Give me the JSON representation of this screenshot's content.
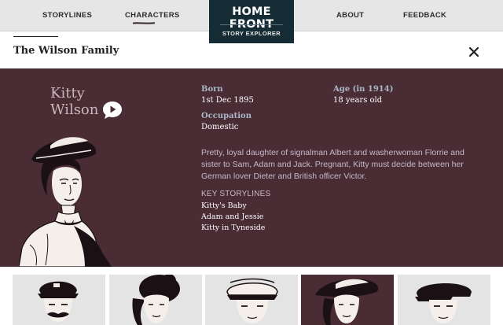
{
  "nav": {
    "links": [
      "STORYLINES",
      "CHARACTERS",
      "ABOUT",
      "FEEDBACK"
    ],
    "active": "CHARACTERS",
    "active_underline_color": "#3d2a33"
  },
  "logo": {
    "title": "HOME FRONT",
    "subtitle": "STORY EXPLORER",
    "bg_color": "#152c35"
  },
  "family": {
    "title": "The Wilson Family",
    "close_icon": "close-icon"
  },
  "profile": {
    "name": "Kitty Wilson",
    "play_icon": "play-speech-bubble-icon",
    "born_label": "Born",
    "born_value": "1st Dec 1895",
    "age_label": "Age (in 1914)",
    "age_value": "18 years old",
    "occupation_label": "Occupation",
    "occupation_value": "Domestic",
    "bio": "Pretty, loyal daughter of signalman Albert and washerwoman Florrie and sister to Sam, Adam and Jack. Pregnant, Kitty must decide between her German lover Dieter and British officer Victor.",
    "key_storylines_heading": "KEY STORYLINES",
    "key_storylines": [
      "Kitty's Baby",
      "Adam and Jessie",
      "Kitty in Tyneside"
    ]
  },
  "thumbnails": [
    {
      "icon": "man-peaked-cap-portrait",
      "active": false
    },
    {
      "icon": "woman-updo-portrait",
      "active": false
    },
    {
      "icon": "young-man-cap-portrait",
      "active": false
    },
    {
      "icon": "kitty-hat-portrait",
      "active": true
    },
    {
      "icon": "boy-cap-portrait",
      "active": false
    }
  ],
  "colors": {
    "panel_bg": "#4a2c35",
    "nav_bg": "#e6e6e6",
    "label": "#aab8c7",
    "body_text": "#c6b9c9",
    "name_text": "#c9b6bb"
  }
}
